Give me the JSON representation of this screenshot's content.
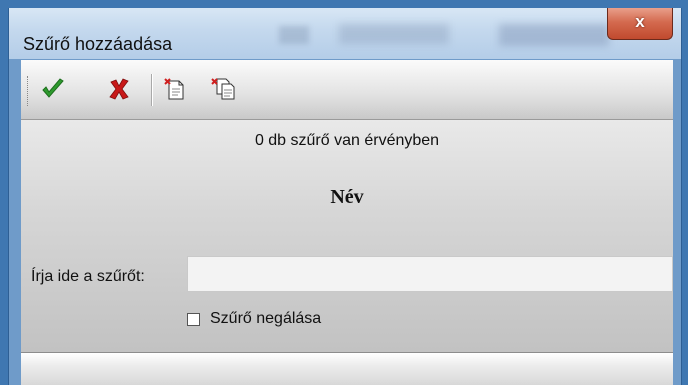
{
  "window": {
    "title": "Szűrő hozzáadása",
    "close_label": "x"
  },
  "toolbar": {
    "buttons": [
      {
        "name": "ok",
        "icon": "green-checkmark-icon",
        "color": "#2e9a2e"
      },
      {
        "name": "cancel",
        "icon": "red-x-icon",
        "color": "#c81818"
      },
      {
        "name": "new-filter",
        "icon": "new-document-icon"
      },
      {
        "name": "copy-filter",
        "icon": "copy-documents-icon"
      }
    ]
  },
  "main": {
    "count_text": "0 db szűrő van érvényben",
    "heading": "Név",
    "filter_label": "Írja ide a szűrőt:",
    "filter_value": "",
    "negate_label": "Szűrő negálása",
    "negate_checked": false
  }
}
